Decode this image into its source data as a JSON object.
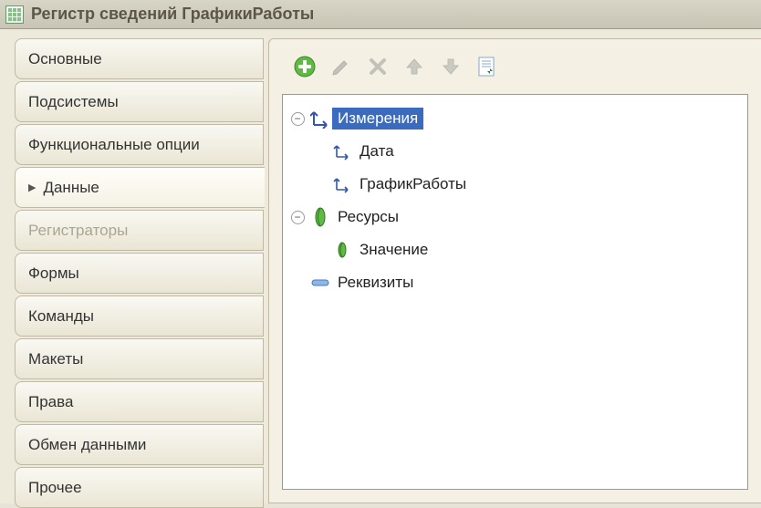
{
  "window": {
    "title": "Регистр сведений ГрафикиРаботы"
  },
  "sidebar": {
    "items": [
      {
        "label": "Основные"
      },
      {
        "label": "Подсистемы"
      },
      {
        "label": "Функциональные опции"
      },
      {
        "label": "Данные"
      },
      {
        "label": "Регистраторы"
      },
      {
        "label": "Формы"
      },
      {
        "label": "Команды"
      },
      {
        "label": "Макеты"
      },
      {
        "label": "Права"
      },
      {
        "label": "Обмен данными"
      },
      {
        "label": "Прочее"
      }
    ]
  },
  "toolbar": {
    "add": "Добавить",
    "edit": "Изменить",
    "delete": "Удалить",
    "move_up": "Вверх",
    "move_down": "Вниз",
    "properties": "Свойства"
  },
  "tree": {
    "dimensions": {
      "label": "Измерения"
    },
    "date": {
      "label": "Дата"
    },
    "work_schedule": {
      "label": "ГрафикРаботы"
    },
    "resources": {
      "label": "Ресурсы"
    },
    "value": {
      "label": "Значение"
    },
    "attributes": {
      "label": "Реквизиты"
    }
  }
}
